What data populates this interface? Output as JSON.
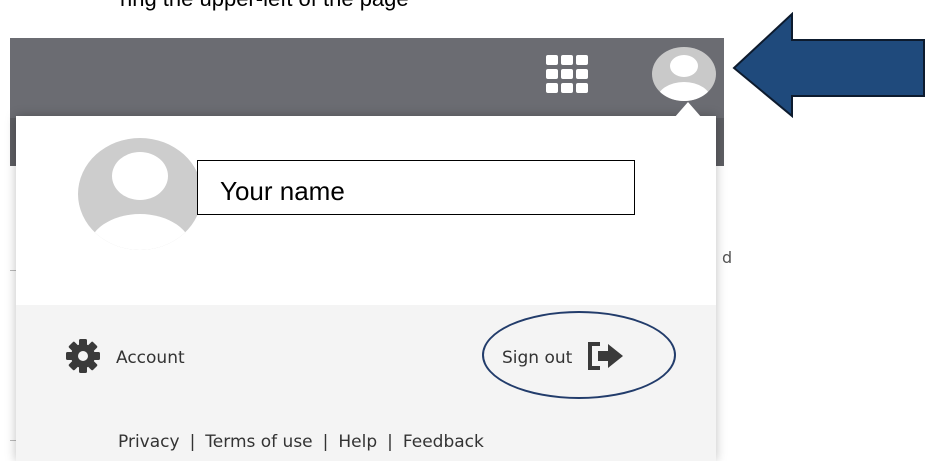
{
  "caption_fragment": "ring the upper-left of the page",
  "page_fragment": "d",
  "header": {
    "apps_icon": "grid-icon",
    "avatar_icon": "user-avatar-icon"
  },
  "profile": {
    "name": "Your name",
    "avatar_icon": "user-avatar-icon"
  },
  "actions": {
    "account_label": "Account",
    "account_icon": "gear-icon",
    "signout_label": "Sign out",
    "signout_icon": "sign-out-arrow-icon"
  },
  "footer_links": [
    "Privacy",
    "Terms of use",
    "Help",
    "Feedback"
  ],
  "footer_separator": "|",
  "colors": {
    "header_bg": "#6b6c72",
    "annotation_blue": "#1f4a7c",
    "circle_outline": "#223c6b"
  }
}
